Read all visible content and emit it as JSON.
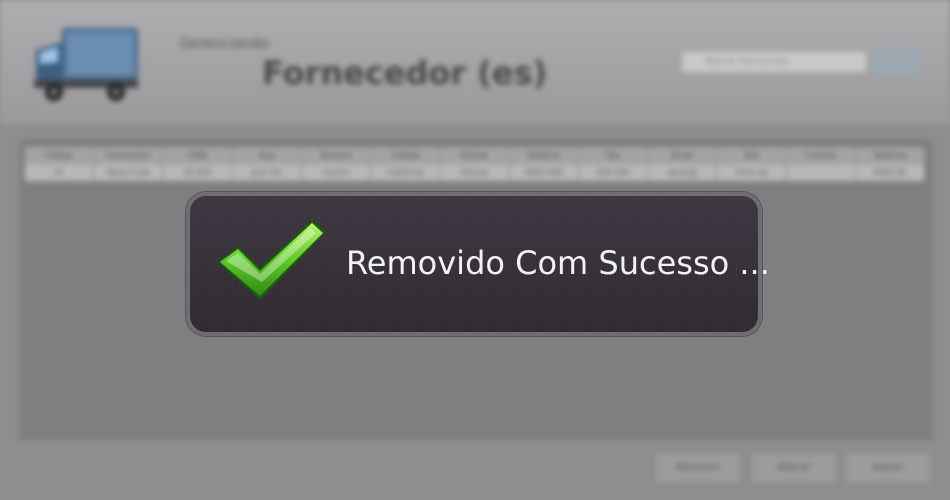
{
  "header": {
    "subtitle": "Gerenciando",
    "title": "Fornecedor (es)",
    "search_placeholder": "Buscar Fornecedor"
  },
  "table": {
    "columns": [
      "Código",
      "Fornecedor",
      "CNPJ",
      "Rua",
      "Número",
      "Cidade",
      "Estado",
      "Telefone",
      "Fax",
      "Email",
      "Site",
      "Contato",
      "Telefone"
    ],
    "rows": [
      [
        "01",
        "Apolo Ltda",
        "00.000",
        "Jose Fer",
        "Centro",
        "Califórnia",
        "Paraná",
        "0000-000",
        "000-000",
        "apolo@",
        "Ferm ap",
        "",
        "0000-00"
      ]
    ]
  },
  "footer": {
    "buttons": [
      "Remover",
      "Alterar",
      "Salvar"
    ]
  },
  "toast": {
    "message": "Removido Com Sucesso ...",
    "icon": "check-icon",
    "accent_color": "#5ecb2a"
  }
}
